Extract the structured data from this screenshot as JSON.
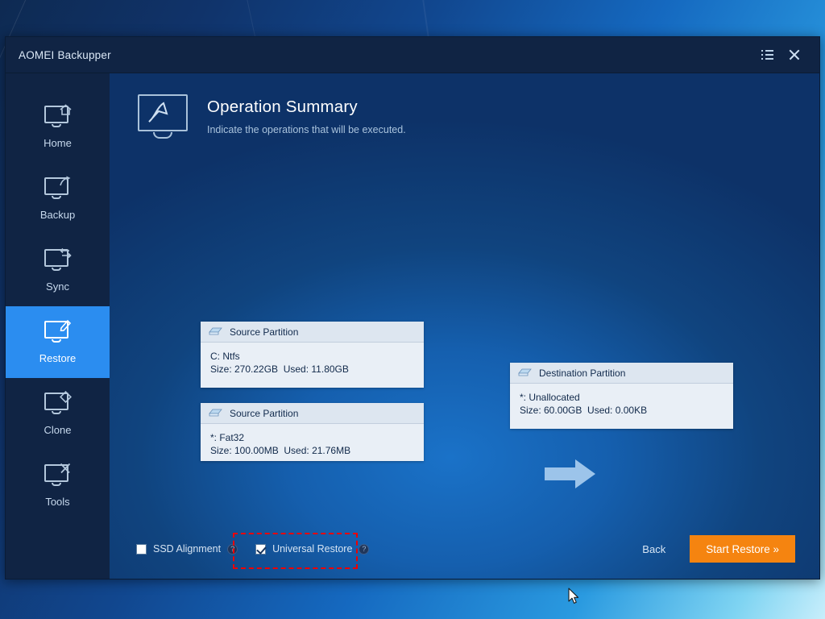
{
  "window": {
    "title": "AOMEI Backupper",
    "menu_icon": "list-menu-icon",
    "close_icon": "close-icon"
  },
  "sidebar": {
    "items": [
      {
        "label": "Home",
        "icon": "monitor-home-icon",
        "active": false
      },
      {
        "label": "Backup",
        "icon": "monitor-share-icon",
        "active": false
      },
      {
        "label": "Sync",
        "icon": "monitor-sync-icon",
        "active": false
      },
      {
        "label": "Restore",
        "icon": "monitor-restore-icon",
        "active": true
      },
      {
        "label": "Clone",
        "icon": "monitor-clone-icon",
        "active": false
      },
      {
        "label": "Tools",
        "icon": "monitor-tools-icon",
        "active": false
      }
    ]
  },
  "header": {
    "icon": "monitor-chart-icon",
    "title": "Operation Summary",
    "subtitle": "Indicate the operations that will be executed."
  },
  "diagram": {
    "arrow_icon": "arrow-right-icon",
    "source_cards": [
      {
        "heading": "Source Partition",
        "icon": "disk-partition-icon",
        "line1": "C: Ntfs",
        "line2": "Size: 270.22GB  Used: 11.80GB"
      },
      {
        "heading": "Source Partition",
        "icon": "disk-partition-icon",
        "line1": "*: Fat32",
        "line2": "Size: 100.00MB  Used: 21.76MB"
      }
    ],
    "destination_card": {
      "heading": "Destination Partition",
      "icon": "disk-partition-icon",
      "line1": "*: Unallocated",
      "line2": "Size: 60.00GB  Used: 0.00KB"
    }
  },
  "footer": {
    "ssd_alignment": {
      "label": "SSD Alignment",
      "checked": false,
      "help_icon": "help-icon",
      "help_glyph": "?"
    },
    "universal_restore": {
      "label": "Universal Restore",
      "checked": true,
      "help_icon": "help-icon",
      "help_glyph": "?"
    },
    "back_label": "Back",
    "start_label": "Start Restore »"
  },
  "colors": {
    "accent_blue": "#2b8df0",
    "action_orange": "#f58410",
    "sidebar_navy": "#102444",
    "highlight_red": "#ee0000",
    "card_body": "#e9eff6",
    "card_head": "#dde6f0"
  }
}
